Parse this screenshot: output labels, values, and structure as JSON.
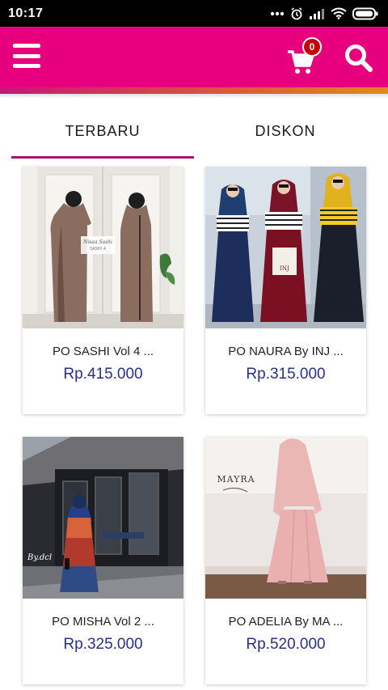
{
  "status_bar": {
    "time": "10:17"
  },
  "header": {
    "cart_count": "0"
  },
  "tabs": [
    {
      "label": "TERBARU"
    },
    {
      "label": "DISKON"
    }
  ],
  "products": [
    {
      "name": "PO SASHI Vol 4 ...",
      "price": "Rp.415.000",
      "image_label": "Nisaa Sashi"
    },
    {
      "name": "PO NAURA By INJ ...",
      "price": "Rp.315.000",
      "image_label": "INJ"
    },
    {
      "name": "PO MISHA Vol 2 ...",
      "price": "Rp.325.000",
      "image_label": "By.dcl"
    },
    {
      "name": "PO ADELIA By MA ...",
      "price": "Rp.520.000",
      "image_label": "MAYRA"
    }
  ],
  "colors": {
    "brand": "#e6007e",
    "price": "#2a2f8f",
    "tab_indicator": "#a01472"
  }
}
